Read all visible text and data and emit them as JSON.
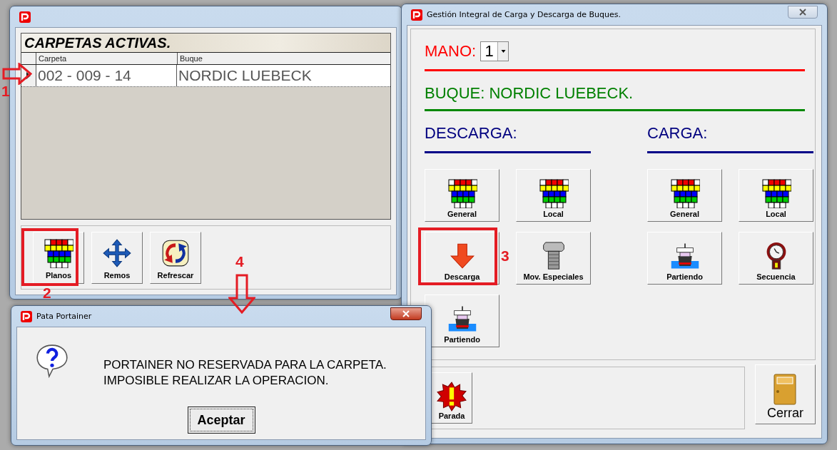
{
  "list_window": {
    "heading": "CARPETAS ACTIVAS.",
    "columns": [
      "Carpeta",
      "Buque"
    ],
    "rows": [
      {
        "cells": [
          "002 - 009 - 14",
          "NORDIC LUEBECK"
        ],
        "selected": true
      }
    ],
    "buttons": [
      "Planos",
      "Remos",
      "Refrescar"
    ]
  },
  "main_window": {
    "title": "Gestión Integral de Carga y Descarga de Buques.",
    "mano_label": "MANO:",
    "mano_value": "1",
    "buque": "BUQUE: NORDIC LUEBECK.",
    "sections": [
      {
        "title": "DESCARGA:",
        "buttons": [
          "General",
          "Local",
          "Descarga",
          "Mov. Especiales",
          "Partiendo"
        ]
      },
      {
        "title": "CARGA:",
        "buttons": [
          "General",
          "Local",
          "Partiendo",
          "Secuencia"
        ]
      }
    ],
    "footer_buttons": [
      "Parada",
      "Cerrar"
    ]
  },
  "dialog": {
    "title": "Pata Portainer",
    "message": [
      "PORTAINER NO RESERVADA PARA LA CARPETA.",
      "IMPOSIBLE REALIZAR LA OPERACION."
    ],
    "button": "Aceptar"
  },
  "annotations": [
    {
      "kind": "arrow-right",
      "label": "1"
    },
    {
      "kind": "box",
      "label": "2"
    },
    {
      "kind": "box",
      "label": "3"
    },
    {
      "kind": "arrow-down",
      "label": "4"
    }
  ]
}
